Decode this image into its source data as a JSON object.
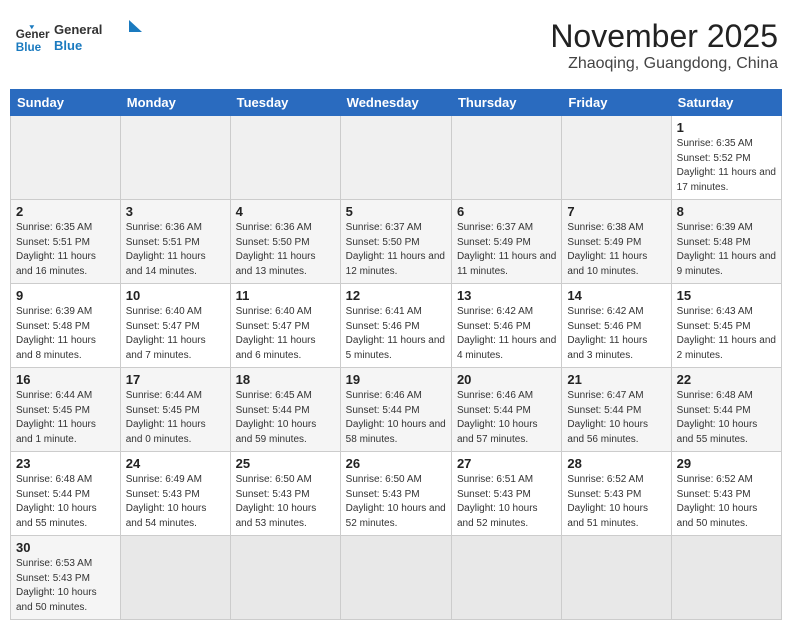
{
  "header": {
    "logo_general": "General",
    "logo_blue": "Blue",
    "month": "November 2025",
    "location": "Zhaoqing, Guangdong, China"
  },
  "weekdays": [
    "Sunday",
    "Monday",
    "Tuesday",
    "Wednesday",
    "Thursday",
    "Friday",
    "Saturday"
  ],
  "weeks": [
    [
      {
        "day": "",
        "text": ""
      },
      {
        "day": "",
        "text": ""
      },
      {
        "day": "",
        "text": ""
      },
      {
        "day": "",
        "text": ""
      },
      {
        "day": "",
        "text": ""
      },
      {
        "day": "",
        "text": ""
      },
      {
        "day": "1",
        "text": "Sunrise: 6:35 AM\nSunset: 5:52 PM\nDaylight: 11 hours and 17 minutes."
      }
    ],
    [
      {
        "day": "2",
        "text": "Sunrise: 6:35 AM\nSunset: 5:51 PM\nDaylight: 11 hours and 16 minutes."
      },
      {
        "day": "3",
        "text": "Sunrise: 6:36 AM\nSunset: 5:51 PM\nDaylight: 11 hours and 14 minutes."
      },
      {
        "day": "4",
        "text": "Sunrise: 6:36 AM\nSunset: 5:50 PM\nDaylight: 11 hours and 13 minutes."
      },
      {
        "day": "5",
        "text": "Sunrise: 6:37 AM\nSunset: 5:50 PM\nDaylight: 11 hours and 12 minutes."
      },
      {
        "day": "6",
        "text": "Sunrise: 6:37 AM\nSunset: 5:49 PM\nDaylight: 11 hours and 11 minutes."
      },
      {
        "day": "7",
        "text": "Sunrise: 6:38 AM\nSunset: 5:49 PM\nDaylight: 11 hours and 10 minutes."
      },
      {
        "day": "8",
        "text": "Sunrise: 6:39 AM\nSunset: 5:48 PM\nDaylight: 11 hours and 9 minutes."
      }
    ],
    [
      {
        "day": "9",
        "text": "Sunrise: 6:39 AM\nSunset: 5:48 PM\nDaylight: 11 hours and 8 minutes."
      },
      {
        "day": "10",
        "text": "Sunrise: 6:40 AM\nSunset: 5:47 PM\nDaylight: 11 hours and 7 minutes."
      },
      {
        "day": "11",
        "text": "Sunrise: 6:40 AM\nSunset: 5:47 PM\nDaylight: 11 hours and 6 minutes."
      },
      {
        "day": "12",
        "text": "Sunrise: 6:41 AM\nSunset: 5:46 PM\nDaylight: 11 hours and 5 minutes."
      },
      {
        "day": "13",
        "text": "Sunrise: 6:42 AM\nSunset: 5:46 PM\nDaylight: 11 hours and 4 minutes."
      },
      {
        "day": "14",
        "text": "Sunrise: 6:42 AM\nSunset: 5:46 PM\nDaylight: 11 hours and 3 minutes."
      },
      {
        "day": "15",
        "text": "Sunrise: 6:43 AM\nSunset: 5:45 PM\nDaylight: 11 hours and 2 minutes."
      }
    ],
    [
      {
        "day": "16",
        "text": "Sunrise: 6:44 AM\nSunset: 5:45 PM\nDaylight: 11 hours and 1 minute."
      },
      {
        "day": "17",
        "text": "Sunrise: 6:44 AM\nSunset: 5:45 PM\nDaylight: 11 hours and 0 minutes."
      },
      {
        "day": "18",
        "text": "Sunrise: 6:45 AM\nSunset: 5:44 PM\nDaylight: 10 hours and 59 minutes."
      },
      {
        "day": "19",
        "text": "Sunrise: 6:46 AM\nSunset: 5:44 PM\nDaylight: 10 hours and 58 minutes."
      },
      {
        "day": "20",
        "text": "Sunrise: 6:46 AM\nSunset: 5:44 PM\nDaylight: 10 hours and 57 minutes."
      },
      {
        "day": "21",
        "text": "Sunrise: 6:47 AM\nSunset: 5:44 PM\nDaylight: 10 hours and 56 minutes."
      },
      {
        "day": "22",
        "text": "Sunrise: 6:48 AM\nSunset: 5:44 PM\nDaylight: 10 hours and 55 minutes."
      }
    ],
    [
      {
        "day": "23",
        "text": "Sunrise: 6:48 AM\nSunset: 5:44 PM\nDaylight: 10 hours and 55 minutes."
      },
      {
        "day": "24",
        "text": "Sunrise: 6:49 AM\nSunset: 5:43 PM\nDaylight: 10 hours and 54 minutes."
      },
      {
        "day": "25",
        "text": "Sunrise: 6:50 AM\nSunset: 5:43 PM\nDaylight: 10 hours and 53 minutes."
      },
      {
        "day": "26",
        "text": "Sunrise: 6:50 AM\nSunset: 5:43 PM\nDaylight: 10 hours and 52 minutes."
      },
      {
        "day": "27",
        "text": "Sunrise: 6:51 AM\nSunset: 5:43 PM\nDaylight: 10 hours and 52 minutes."
      },
      {
        "day": "28",
        "text": "Sunrise: 6:52 AM\nSunset: 5:43 PM\nDaylight: 10 hours and 51 minutes."
      },
      {
        "day": "29",
        "text": "Sunrise: 6:52 AM\nSunset: 5:43 PM\nDaylight: 10 hours and 50 minutes."
      }
    ],
    [
      {
        "day": "30",
        "text": "Sunrise: 6:53 AM\nSunset: 5:43 PM\nDaylight: 10 hours and 50 minutes."
      },
      {
        "day": "",
        "text": ""
      },
      {
        "day": "",
        "text": ""
      },
      {
        "day": "",
        "text": ""
      },
      {
        "day": "",
        "text": ""
      },
      {
        "day": "",
        "text": ""
      },
      {
        "day": "",
        "text": ""
      }
    ]
  ]
}
